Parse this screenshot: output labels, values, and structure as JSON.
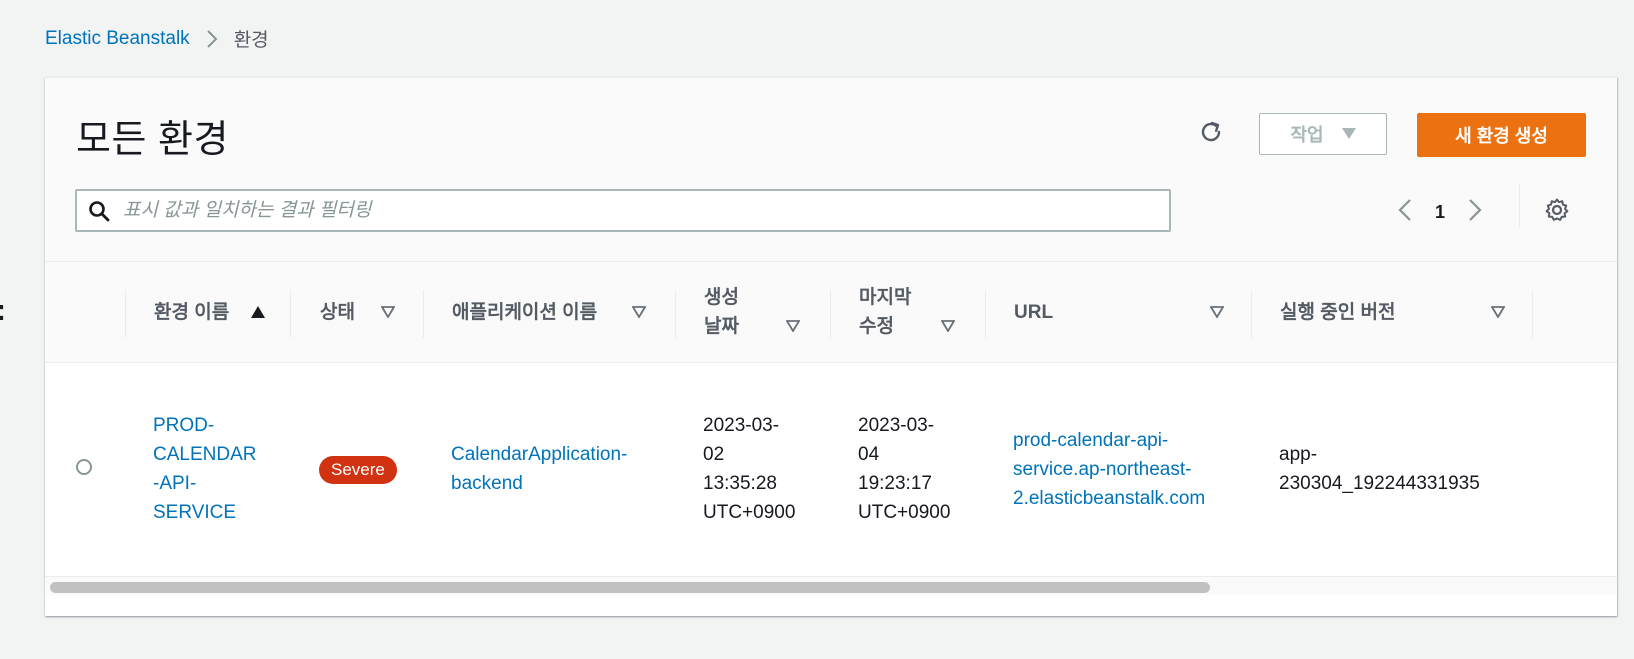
{
  "breadcrumb": {
    "root": "Elastic Beanstalk",
    "current": "환경"
  },
  "page": {
    "title": "모든 환경"
  },
  "toolbar": {
    "actions_label": "작업",
    "create_label": "새 환경 생성"
  },
  "search": {
    "placeholder": "표시 값과 일치하는 결과 필터링"
  },
  "pagination": {
    "current_page": "1"
  },
  "table": {
    "columns": {
      "name": "환경 이름",
      "status": "상태",
      "application": "애플리케이션 이름",
      "created_line1": "생성",
      "created_line2": "날짜",
      "modified_line1": "마지막",
      "modified_line2": "수정",
      "url": "URL",
      "version": "실행 중인 버전"
    },
    "rows": [
      {
        "name_lines": [
          "PROD-",
          "CALENDAR",
          "-API-",
          "SERVICE"
        ],
        "status": "Severe",
        "application_lines": [
          "CalendarApplication-",
          "backend"
        ],
        "created_lines": [
          "2023-03-",
          "02",
          "13:35:28",
          "UTC+0900"
        ],
        "modified_lines": [
          "2023-03-",
          "04",
          "19:23:17",
          "UTC+0900"
        ],
        "url_lines": [
          "prod-calendar-api-",
          "service.ap-northeast-",
          "2.elasticbeanstalk.com"
        ],
        "version_lines": [
          "app-",
          "230304_192244331935"
        ]
      }
    ]
  },
  "colors": {
    "link": "#0073bb",
    "primary_button": "#ec7211",
    "severe_badge": "#d13212",
    "background": "#f2f3f3"
  },
  "icons": {
    "breadcrumb_separator": "chevron-right-icon",
    "refresh": "refresh-icon",
    "actions_dropdown": "caret-down-icon",
    "search": "search-icon",
    "prev_page": "chevron-left-icon",
    "next_page": "chevron-right-icon",
    "settings": "gear-icon",
    "sort_ascending": "sort-ascending-icon",
    "sort_unsorted": "sort-unsorted-icon"
  }
}
